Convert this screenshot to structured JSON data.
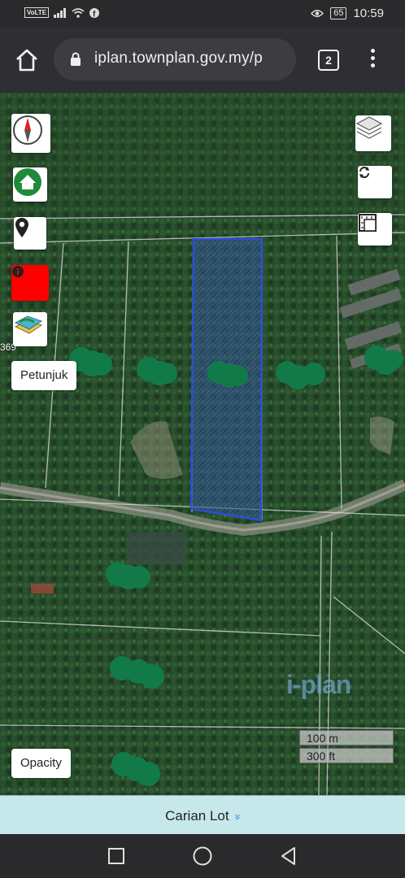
{
  "status_bar": {
    "carrier_badge": "VoLTE",
    "battery": "65",
    "time": "10:59"
  },
  "browser": {
    "url": "iplan.townplan.gov.my/p",
    "tab_count": "2"
  },
  "map": {
    "parcel_label": "369",
    "buttons": {
      "petunjuk": "Petunjuk",
      "opacity": "Opacity"
    },
    "scale": {
      "metric": "100 m",
      "imperial": "300 ft"
    },
    "watermark": "i-plan",
    "colors": {
      "highlight_fill": "#2c4f8a",
      "highlight_stroke": "#2b4fd6",
      "marker": "#117a48",
      "info_button": "#ff0000"
    }
  },
  "footer": {
    "carian_lot": "Carian Lot",
    "chevron": "«"
  }
}
